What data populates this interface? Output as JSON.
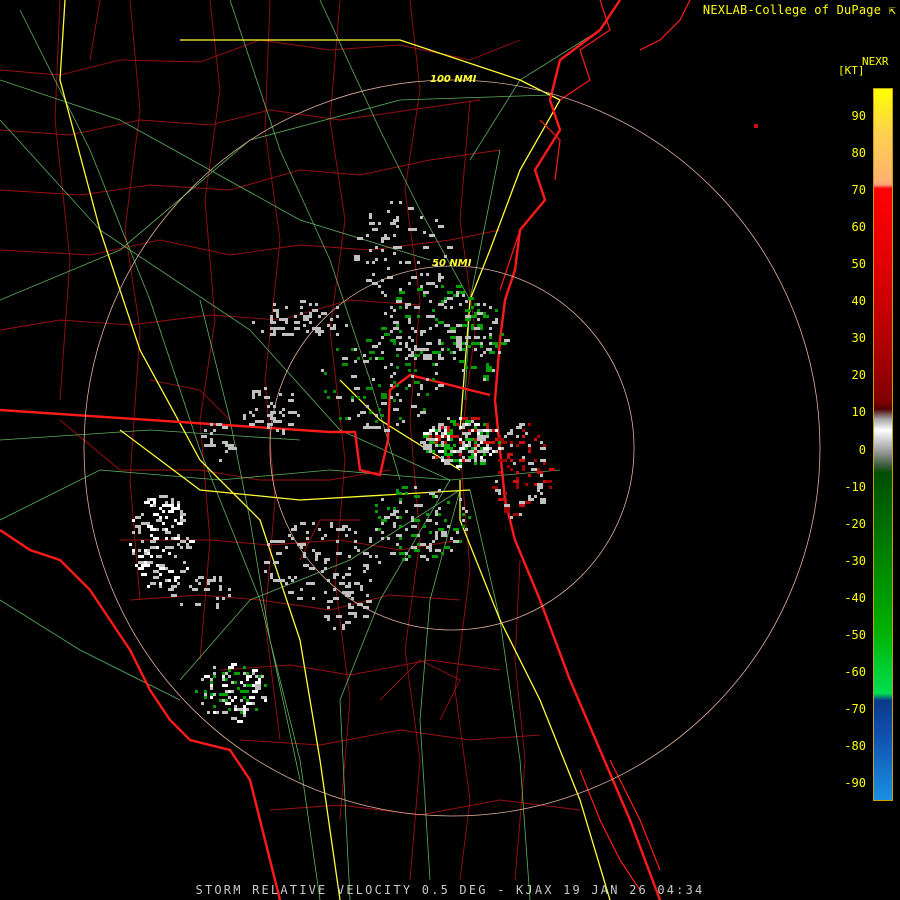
{
  "header": {
    "credit": "NEXLAB-College of DuPage"
  },
  "legend": {
    "product": "NEXR",
    "unit": "[KT]",
    "ticks": [
      "90",
      "80",
      "70",
      "60",
      "50",
      "40",
      "30",
      "20",
      "10",
      "0",
      "-10",
      "-20",
      "-30",
      "-40",
      "-50",
      "-60",
      "-70",
      "-80",
      "-90"
    ]
  },
  "rings": {
    "inner_label": "50 NMI",
    "outer_label": "100 NMI"
  },
  "footer": {
    "caption": "STORM RELATIVE VELOCITY 0.5 DEG - KJAX 19 JAN 26 04:34"
  },
  "colors": {
    "state_border": "#ff1a1a",
    "county_border": "#a01010",
    "highway": "#ffff33",
    "road": "#7fd67f",
    "ring": "#e8b8a0",
    "inbound_green": "#00cc00",
    "outbound_red": "#cc1010",
    "near_zero_gray": "#c0c0c0"
  }
}
